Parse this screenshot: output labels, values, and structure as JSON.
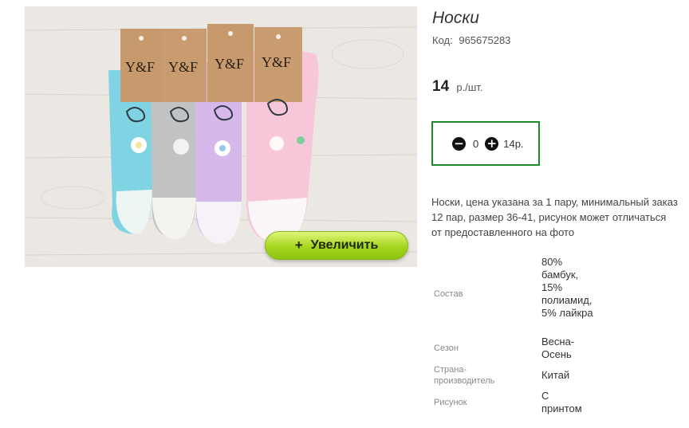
{
  "product": {
    "title": "Носки",
    "code_label": "Код:",
    "code": "965675283",
    "price": "14",
    "price_unit": "р./шт.",
    "zoom_label": "Увеличить",
    "zoom_icon": "plus-icon",
    "brand": "Y&F",
    "description": "Носки, цена указана за 1 пару, минимальный заказ 12 пар, размер 36-41, рисунок может отличаться от предоставленного на фото"
  },
  "cart": {
    "quantity": "0",
    "total": "14р.",
    "minus_icon": "minus-circle-icon",
    "plus_icon": "plus-circle-icon"
  },
  "properties": [
    {
      "label": "Состав",
      "value": "80% бамбук, 15% полиамид, 5% лайкра"
    },
    {
      "label": "Сезон",
      "value": "Весна-Осень"
    },
    {
      "label": "Страна-производитель",
      "value": "Китай"
    },
    {
      "label": "Рисунок",
      "value": "С принтом"
    }
  ],
  "colors": {
    "cart_border": "#1a8a26",
    "zoom_button": "#a6d61e",
    "sock_blue": "#7fd3e3",
    "sock_gray": "#bdbdbd",
    "sock_lilac": "#d6b8ea",
    "sock_pink": "#f7c6d8"
  }
}
